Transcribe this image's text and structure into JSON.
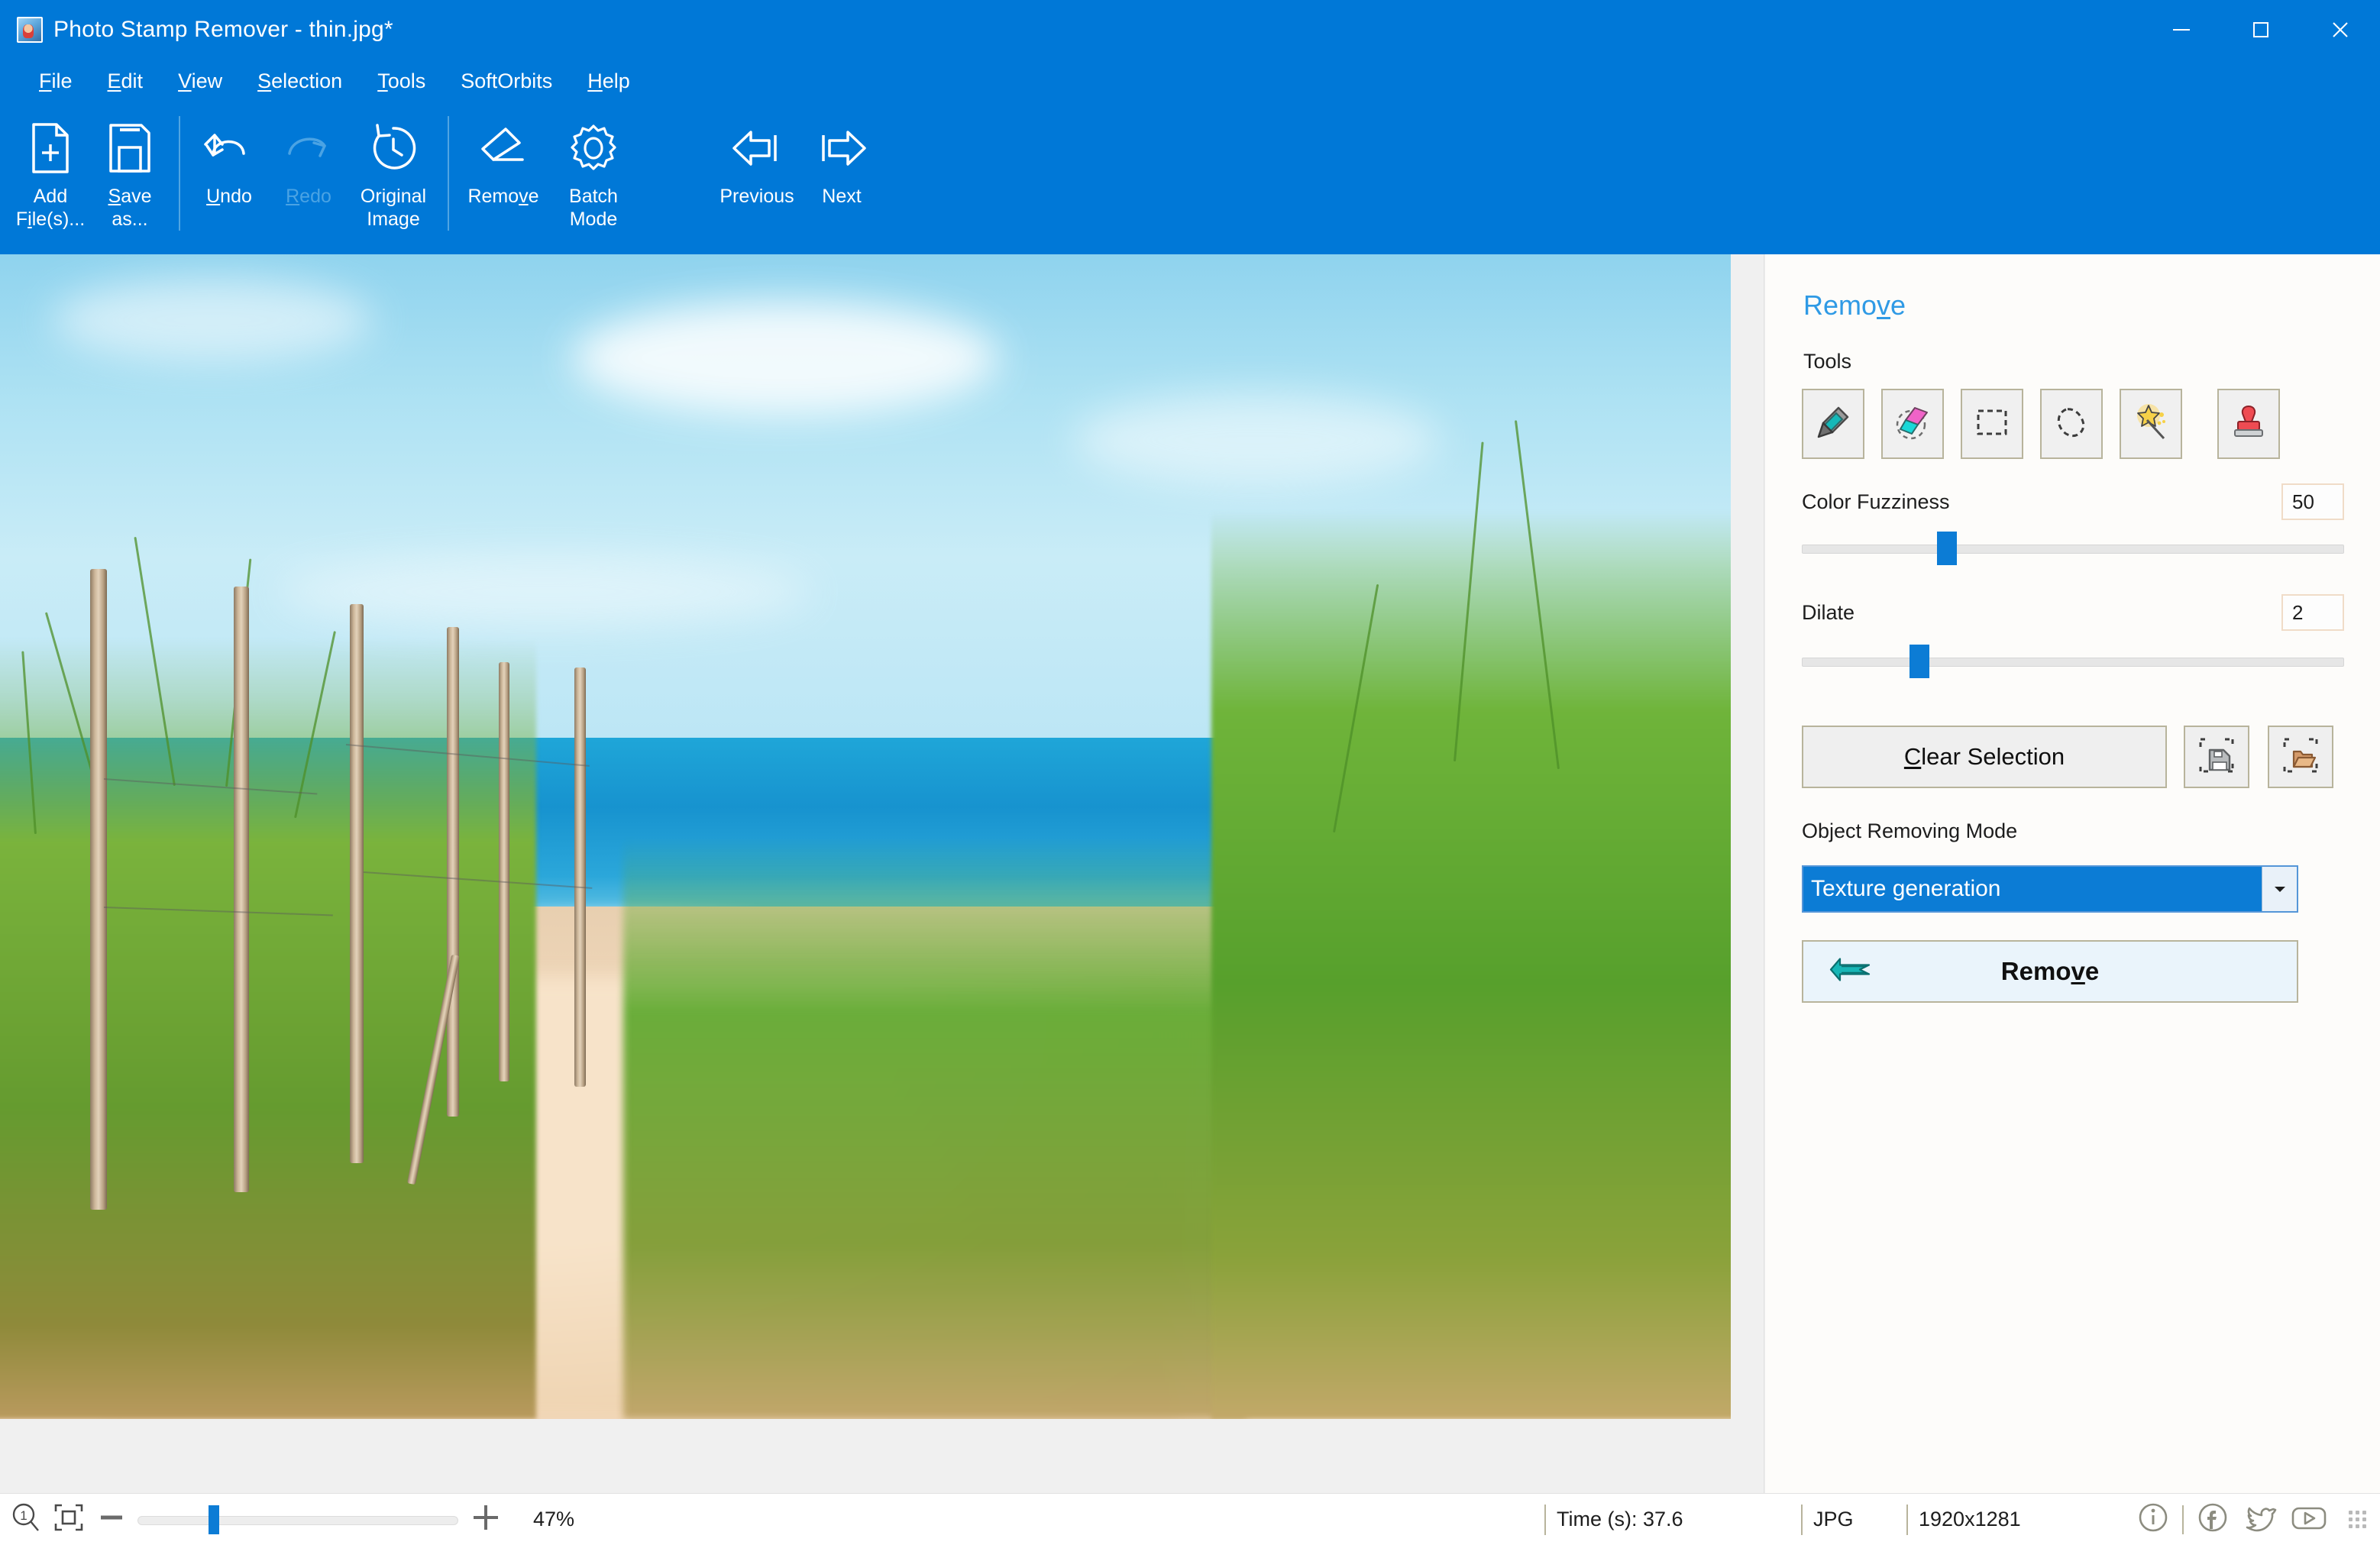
{
  "window": {
    "title": "Photo Stamp Remover - thin.jpg*",
    "app_icon": "photo-thumbnail-icon",
    "minimize_label": "minimize-icon",
    "maximize_label": "maximize-icon",
    "close_label": "close-icon",
    "titlebar_color": "#0078d7"
  },
  "menu": {
    "items": [
      {
        "label": "File",
        "accel": "F"
      },
      {
        "label": "Edit",
        "accel": "E"
      },
      {
        "label": "View",
        "accel": "V"
      },
      {
        "label": "Selection",
        "accel": "S"
      },
      {
        "label": "Tools",
        "accel": "T"
      },
      {
        "label": "SoftOrbits",
        "accel": ""
      },
      {
        "label": "Help",
        "accel": "H"
      }
    ]
  },
  "toolbar": {
    "add_files": "Add\nFile(s)...",
    "save_as": "Save\nas...",
    "undo": "Undo",
    "redo": "Redo",
    "original_image": "Original\nImage",
    "remove": "Remove",
    "batch_mode": "Batch\nMode",
    "previous": "Previous",
    "next": "Next",
    "redo_enabled": "false"
  },
  "panel": {
    "title": "Remove",
    "tools_label": "Tools",
    "tools": [
      {
        "name": "marker-tool",
        "icon": "marker-icon"
      },
      {
        "name": "eraser-tool",
        "icon": "eraser-icon"
      },
      {
        "name": "rectangle-select-tool",
        "icon": "rectangle-select-icon"
      },
      {
        "name": "lasso-select-tool",
        "icon": "lasso-icon"
      },
      {
        "name": "magic-wand-tool",
        "icon": "magic-wand-icon"
      },
      {
        "name": "stamp-tool",
        "icon": "stamp-icon"
      }
    ],
    "color_fuzziness": {
      "label": "Color Fuzziness",
      "value": "50",
      "slider_pct": 26
    },
    "dilate": {
      "label": "Dilate",
      "value": "2",
      "slider_pct": 21
    },
    "clear_selection": "Clear Selection",
    "save_selection_icon": "save-selection-icon",
    "open_selection_icon": "open-selection-icon",
    "object_removing_mode_label": "Object Removing Mode",
    "object_removing_mode_value": "Texture generation",
    "remove_button": "Remove",
    "accent_color": "#2f9ae5",
    "selected_combo_color": "#0c7cd5"
  },
  "statusbar": {
    "zoom_actual_icon": "zoom-actual-size-icon",
    "zoom_fit_icon": "fit-to-window-icon",
    "zoom_out_icon": "minus-icon",
    "zoom_in_icon": "plus-icon",
    "zoom_percent": "47%",
    "zoom_slider_pct": 24,
    "time": "Time (s): 37.6",
    "format": "JPG",
    "dimensions": "1920x1281",
    "info_icon": "info-icon",
    "facebook_icon": "facebook-icon",
    "twitter_icon": "twitter-icon",
    "youtube_icon": "youtube-icon"
  },
  "photo": {
    "description": "beach dune path with wooden fence posts, marram grass, sand and blue sea"
  }
}
